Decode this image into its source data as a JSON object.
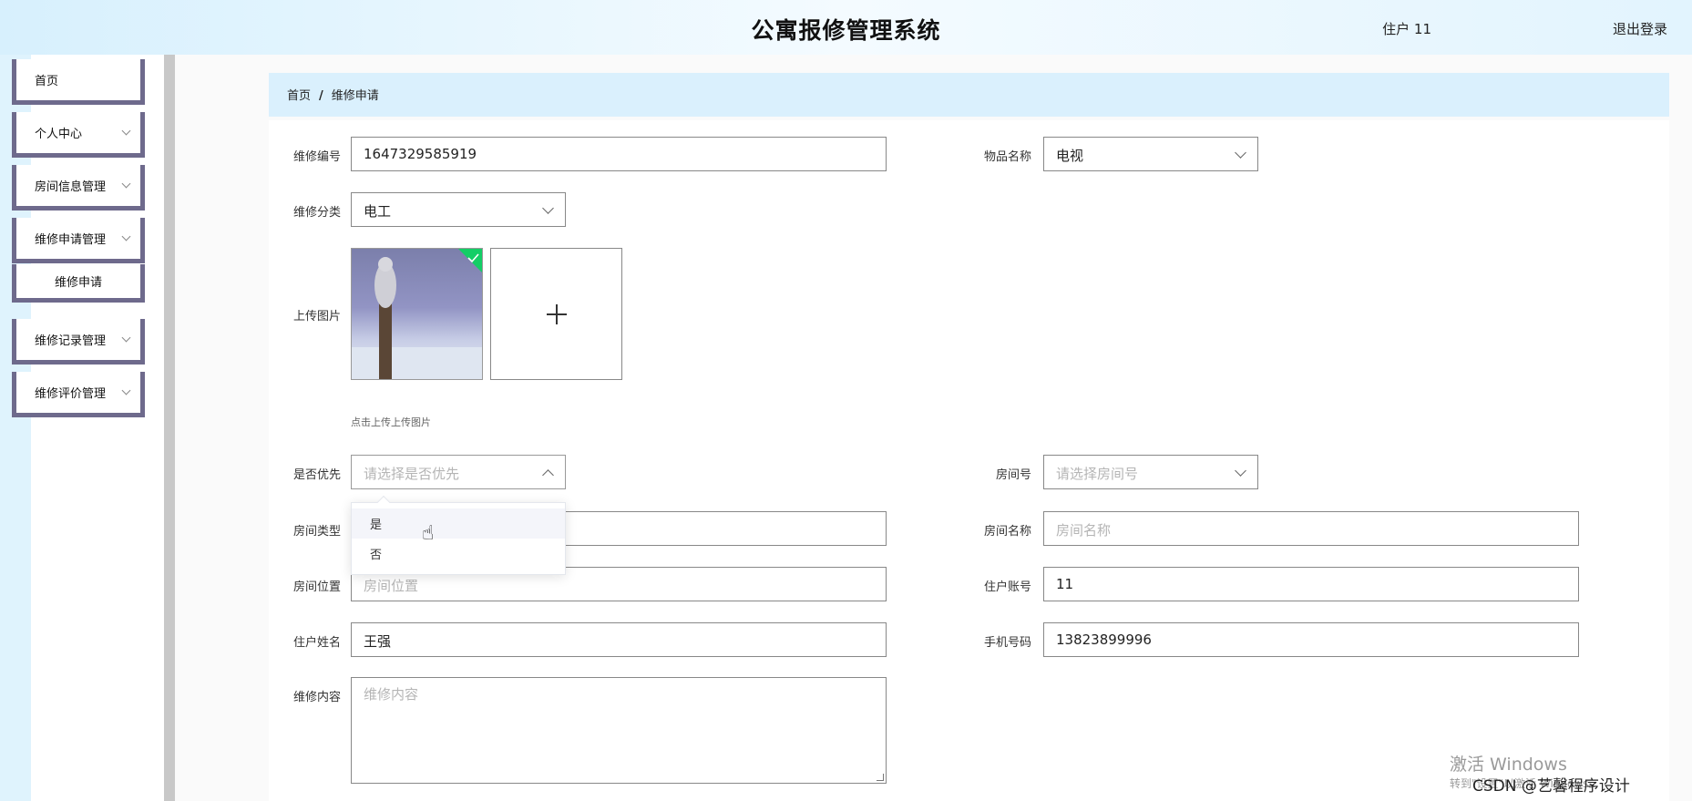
{
  "header": {
    "title": "公寓报修管理系统",
    "user": "住户 11",
    "logout": "退出登录"
  },
  "sidebar": {
    "items": [
      {
        "label": "首页"
      },
      {
        "label": "个人中心"
      },
      {
        "label": "房间信息管理"
      },
      {
        "label": "维修申请管理"
      },
      {
        "label": "维修申请"
      },
      {
        "label": "维修记录管理"
      },
      {
        "label": "维修评价管理"
      }
    ]
  },
  "breadcrumb": {
    "home": "首页",
    "separator": "/",
    "current": "维修申请"
  },
  "form": {
    "repair_no": {
      "label": "维修编号",
      "value": "1647329585919"
    },
    "item_name": {
      "label": "物品名称",
      "value": "电视"
    },
    "category": {
      "label": "维修分类",
      "value": "电工"
    },
    "image": {
      "label": "上传图片",
      "tip": "点击上传上传图片"
    },
    "priority": {
      "label": "是否优先",
      "placeholder": "请选择是否优先",
      "options": [
        "是",
        "否"
      ]
    },
    "room_no": {
      "label": "房间号",
      "placeholder": "请选择房间号"
    },
    "room_type": {
      "label": "房间类型",
      "value": ""
    },
    "room_name": {
      "label": "房间名称",
      "placeholder": "房间名称"
    },
    "room_location": {
      "label": "房间位置",
      "placeholder": "房间位置"
    },
    "account": {
      "label": "住户账号",
      "value": "11"
    },
    "resident_name": {
      "label": "住户姓名",
      "value": "王强"
    },
    "phone": {
      "label": "手机号码",
      "value": "13823899996"
    },
    "content": {
      "label": "维修内容",
      "placeholder": "维修内容"
    }
  },
  "watermark": {
    "line1": "激活 Windows",
    "line2": "转到\"设置\"以激活 Windows。",
    "csdn": "CSDN @艺馨程序设计"
  },
  "colors": {
    "header_bg": "#e2f4fe",
    "breadcrumb_bg": "#daf0fd",
    "nav_border": "#6e6a8c",
    "upload_success": "#13ce66"
  }
}
